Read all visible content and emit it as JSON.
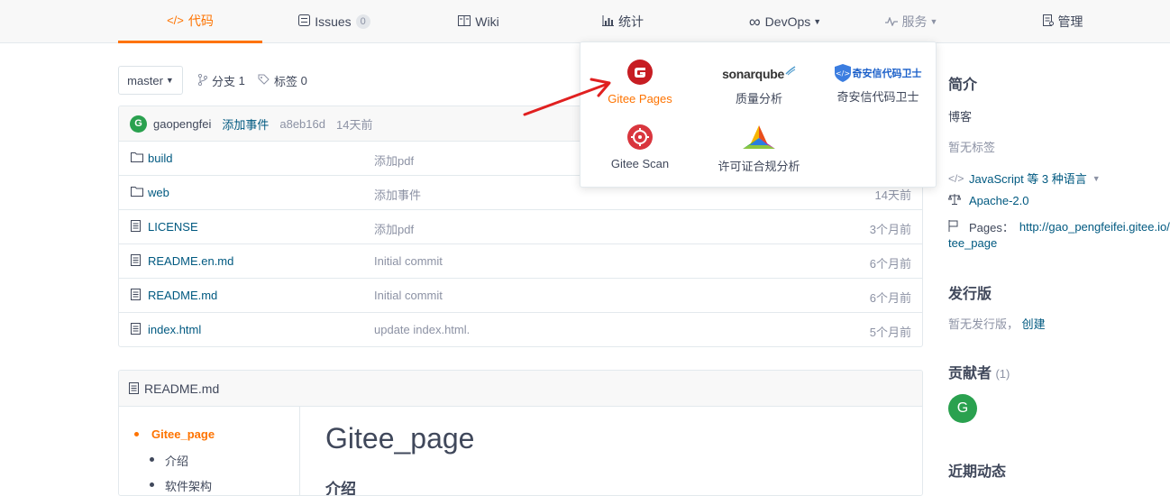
{
  "nav": {
    "items": [
      {
        "label": "代码",
        "icon": "</>",
        "active": true
      },
      {
        "label": "Issues",
        "badge": "0"
      },
      {
        "label": "Wiki"
      },
      {
        "label": "统计"
      },
      {
        "label": "DevOps"
      },
      {
        "label": "服务"
      },
      {
        "label": "管理"
      }
    ]
  },
  "branch": {
    "current": "master",
    "branches_label": "分支",
    "branches_count": "1",
    "tags_label": "标签",
    "tags_count": "0"
  },
  "commit": {
    "avatar": "G",
    "user": "gaopengfei",
    "message": "添加事件",
    "sha": "a8eb16d",
    "time": "14天前"
  },
  "files": [
    {
      "type": "folder",
      "name": "build",
      "commit": "添加pdf",
      "time": ""
    },
    {
      "type": "folder",
      "name": "web",
      "commit": "添加事件",
      "time": "14天前"
    },
    {
      "type": "file",
      "name": "LICENSE",
      "commit": "添加pdf",
      "time": "3个月前"
    },
    {
      "type": "file",
      "name": "README.en.md",
      "commit": "Initial commit",
      "time": "6个月前"
    },
    {
      "type": "file",
      "name": "README.md",
      "commit": "Initial commit",
      "time": "6个月前"
    },
    {
      "type": "file",
      "name": "index.html",
      "commit": "update index.html.",
      "time": "5个月前"
    }
  ],
  "readme": {
    "filename": "README.md",
    "toc": [
      "Gitee_page",
      "介绍",
      "软件架构"
    ],
    "title": "Gitee_page",
    "h2": "介绍"
  },
  "sidebar": {
    "intro_title": "简介",
    "blog": "博客",
    "no_tags": "暂无标签",
    "language": "JavaScript 等 3 种语言",
    "license": "Apache-2.0",
    "pages_label": "Pages：",
    "pages_url": "http://gao_pengfeifei.gitee.io/gi",
    "pages_url_cont": "tee_page",
    "release_title": "发行版",
    "no_release": "暂无发行版，",
    "create": "创建",
    "contributors_title": "贡献者",
    "contributors_count": "(1)",
    "contributor_avatar": "G",
    "activity_title": "近期动态"
  },
  "services_dropdown": [
    {
      "label": "Gitee Pages",
      "icon": "gitee-pages-icon",
      "highlighted": true
    },
    {
      "label": "质量分析",
      "icon": "sonarqube-logo",
      "logo_text": "sonarqube"
    },
    {
      "label": "奇安信代码卫士",
      "icon": "qianxin-icon",
      "logo_text": "奇安信代码卫士"
    },
    {
      "label": "Gitee Scan",
      "icon": "gitee-scan-icon"
    },
    {
      "label": "许可证合规分析",
      "icon": "license-compliance-icon"
    }
  ],
  "colors": {
    "accent": "#fe7300",
    "link": "#005980",
    "muted": "#8c92a4",
    "green": "#2aa14f",
    "arrow": "#e02020"
  }
}
